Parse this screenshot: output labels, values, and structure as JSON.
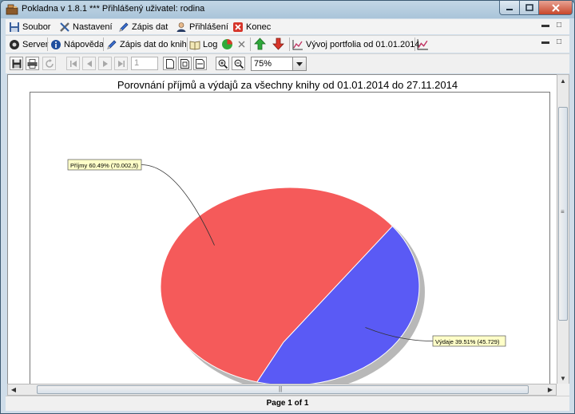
{
  "window": {
    "title": "Pokladna v 1.8.1  ***  Přihlášený uživatel: rodina"
  },
  "menu": {
    "items": [
      {
        "label": "Soubor"
      },
      {
        "label": "Nastavení"
      },
      {
        "label": "Zápis dat"
      },
      {
        "label": "Přihlášení"
      },
      {
        "label": "Konec"
      }
    ]
  },
  "tabs": {
    "items": [
      {
        "label": "Server"
      },
      {
        "label": "Nápověda"
      },
      {
        "label": "Zápis dat do knih"
      },
      {
        "label": "Log"
      },
      {
        "label": "Vývoj portfolia od 01.01.2014"
      }
    ]
  },
  "toolbar": {
    "page_value": "1",
    "zoom_value": "75%"
  },
  "report": {
    "title": "Porovnání příjmů a výdajů za všechny knihy od 01.01.2014 do 27.11.2014"
  },
  "chart_data": {
    "type": "pie",
    "slices": [
      {
        "label": "Příjmy 60.49% (70.002,5)",
        "value": 60.49,
        "color": "#f55a5a"
      },
      {
        "label": "Výdaje 39.51% (45.729)",
        "value": 39.51,
        "color": "#5a5af5"
      }
    ]
  },
  "status": {
    "page_text": "Page 1 of 1"
  },
  "colors": {
    "income": "#f55a5a",
    "expense": "#5a5af5",
    "label_bg": "#ffffc8"
  }
}
